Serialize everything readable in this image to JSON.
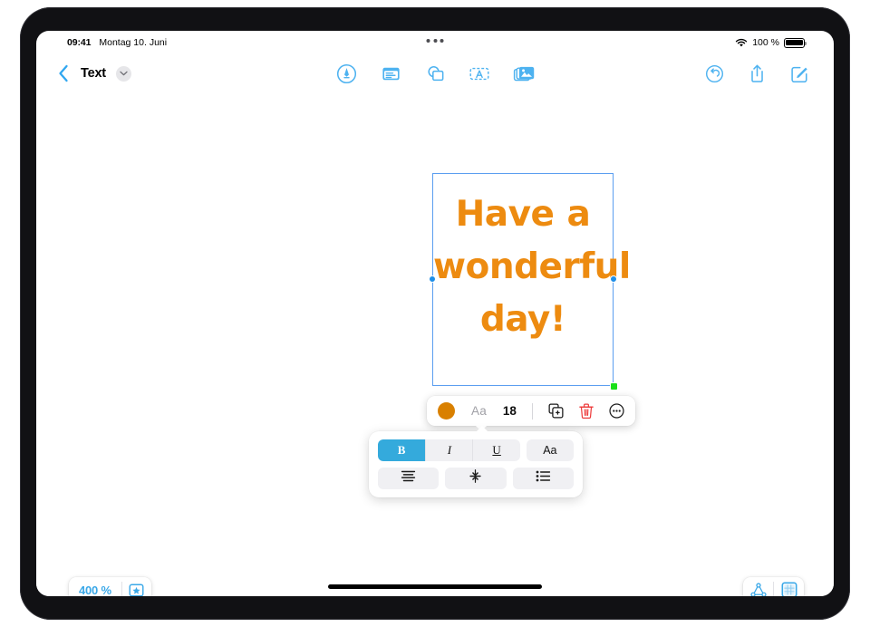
{
  "status_bar": {
    "time": "09:41",
    "date": "Montag 10. Juni",
    "wifi_icon": "wifi-icon",
    "battery_label": "100 %",
    "battery_icon": "battery-full-icon",
    "multitask_handle": "multitask-dots-icon"
  },
  "nav_bar": {
    "back_icon": "chevron-left-icon",
    "document_title": "Text",
    "title_chevron_icon": "chevron-down-icon",
    "center_tools": [
      {
        "name": "pen-tool-icon",
        "label": "Pen"
      },
      {
        "name": "note-tool-icon",
        "label": "Note"
      },
      {
        "name": "shapes-tool-icon",
        "label": "Shapes"
      },
      {
        "name": "text-tool-icon",
        "label": "Text"
      },
      {
        "name": "media-tool-icon",
        "label": "Media"
      }
    ],
    "right_tools": [
      {
        "name": "undo-icon",
        "label": "Undo"
      },
      {
        "name": "share-icon",
        "label": "Share"
      },
      {
        "name": "compose-icon",
        "label": "Compose"
      }
    ]
  },
  "canvas": {
    "textbox": {
      "content": "Have a wonderful day!",
      "text_color": "#ED8B10",
      "selection_border_color": "#5b9ef0",
      "handle_color": "#1f8fe8",
      "rotate_handle_color": "#1ae01a",
      "handles": [
        {
          "name": "resize-handle-left",
          "type": "dot"
        },
        {
          "name": "resize-handle-right",
          "type": "dot"
        },
        {
          "name": "resize-handle-bottom-right",
          "type": "square-green"
        }
      ]
    }
  },
  "format_bar": {
    "color_swatch": "#D98000",
    "color_swatch_name": "text-color-swatch",
    "font_label": "Aa",
    "font_size": "18",
    "duplicate_icon": "duplicate-icon",
    "delete_icon": "trash-icon",
    "more_icon": "more-ellipsis-icon"
  },
  "format_panel": {
    "row1": [
      {
        "name": "bold-button",
        "label": "B",
        "active": true
      },
      {
        "name": "italic-button",
        "label": "I",
        "active": false
      },
      {
        "name": "underline-button",
        "label": "U",
        "active": false
      },
      {
        "name": "font-style-button",
        "label": "Aa",
        "active": false
      }
    ],
    "row2": [
      {
        "name": "text-align-button",
        "icon": "text-align-icon"
      },
      {
        "name": "line-spacing-button",
        "icon": "line-spacing-icon"
      },
      {
        "name": "bullet-list-button",
        "icon": "bullet-list-icon"
      }
    ],
    "active_color": "#34AADC"
  },
  "bottom_bar": {
    "zoom_value": "400 %",
    "zoom_accent_color": "#3aa8e8",
    "favorite_icon": "star-in-square-icon",
    "map_icon": "node-map-icon",
    "canvas_icon": "canvas-grid-icon"
  },
  "home_indicator": "home-indicator"
}
